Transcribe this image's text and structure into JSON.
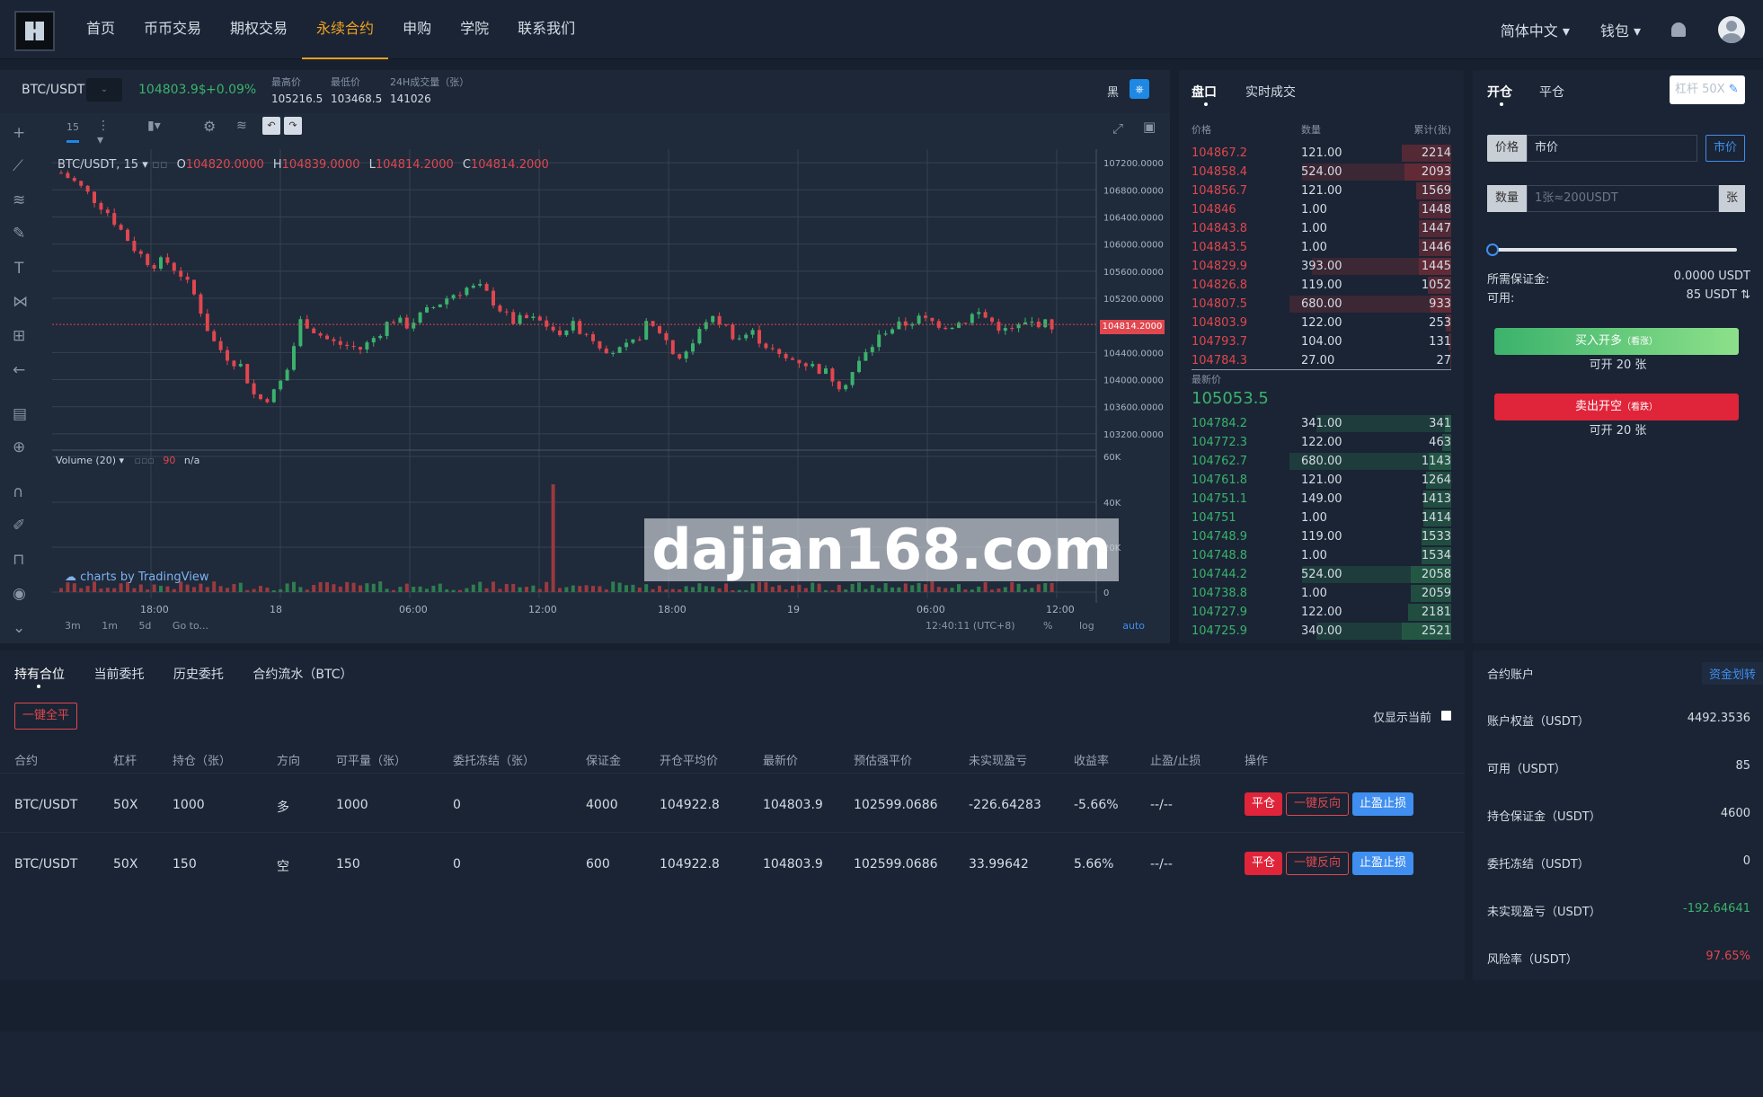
{
  "nav": {
    "items": [
      "首页",
      "币币交易",
      "期权交易",
      "永续合约",
      "申购",
      "学院",
      "联系我们"
    ],
    "active": 3,
    "lang": "简体中文",
    "wallet": "钱包"
  },
  "ticker": {
    "pair": "BTC/USDT",
    "price": "104803.9$",
    "change": "+0.09%",
    "high_label": "最高价",
    "high": "105216.5",
    "low_label": "最低价",
    "low": "103468.5",
    "vol_label": "24H成交量（张）",
    "vol": "141026",
    "theme": "黑"
  },
  "chart": {
    "interval": "15",
    "legend": "BTC/USDT, 15",
    "o": "104820.0000",
    "h": "104839.0000",
    "l": "104814.2000",
    "c": "104814.2000",
    "volume": "Volume (20)",
    "vol_n": "90",
    "vol_na": "n/a",
    "branding": "charts by TradingView",
    "watermark": "dajian168.com",
    "last_price": "104814.2000",
    "time": "12:40:11 (UTC+8)",
    "ranges": [
      "3m",
      "1m",
      "5d",
      "Go to..."
    ],
    "opts": [
      "%",
      "log",
      "auto"
    ]
  },
  "chart_data": {
    "type": "candlestick",
    "x_ticks": [
      "18:00",
      "18",
      "06:00",
      "12:00",
      "18:00",
      "19",
      "06:00",
      "12:00"
    ],
    "y_ticks": [
      "107200.0000",
      "106800.0000",
      "106400.0000",
      "106000.0000",
      "105600.0000",
      "105200.0000",
      "104400.0000",
      "104000.0000",
      "103600.0000",
      "103200.0000"
    ],
    "vol_ticks": [
      "60K",
      "40K",
      "20K",
      "0"
    ],
    "ylim": [
      103000,
      107400
    ],
    "close_path": [
      107050,
      106900,
      106700,
      106500,
      106200,
      105900,
      105700,
      105750,
      105550,
      105200,
      104600,
      104350,
      104200,
      103700,
      103750,
      104100,
      104900,
      104700,
      104550,
      104500,
      104450,
      104650,
      104900,
      104800,
      104950,
      105100,
      105250,
      105350,
      105350,
      105100,
      104850,
      104900,
      104850,
      104700,
      104800,
      104700,
      104500,
      104400,
      104500,
      104800,
      104700,
      104300,
      104500,
      104900,
      104850,
      104600,
      104700,
      104500,
      104300,
      104300,
      104200,
      104100,
      103900,
      104200,
      104500,
      104750,
      104800,
      104900,
      104850,
      104800,
      104850,
      105000,
      104850,
      104700,
      104800,
      104850,
      104800
    ]
  },
  "orderbook": {
    "tabs": [
      "盘口",
      "实时成交"
    ],
    "headers": [
      "价格",
      "数量",
      "累计(张)"
    ],
    "asks": [
      [
        "104867.2",
        "121.00",
        "2214"
      ],
      [
        "104858.4",
        "524.00",
        "2093"
      ],
      [
        "104856.7",
        "121.00",
        "1569"
      ],
      [
        "104846",
        "1.00",
        "1448"
      ],
      [
        "104843.8",
        "1.00",
        "1447"
      ],
      [
        "104843.5",
        "1.00",
        "1446"
      ],
      [
        "104829.9",
        "393.00",
        "1445"
      ],
      [
        "104826.8",
        "119.00",
        "1052"
      ],
      [
        "104807.5",
        "680.00",
        "933"
      ],
      [
        "104803.9",
        "122.00",
        "253"
      ],
      [
        "104793.7",
        "104.00",
        "131"
      ],
      [
        "104784.3",
        "27.00",
        "27"
      ]
    ],
    "mid_label": "最新价",
    "mid": "105053.5",
    "bids": [
      [
        "104784.2",
        "341.00",
        "341"
      ],
      [
        "104772.3",
        "122.00",
        "463"
      ],
      [
        "104762.7",
        "680.00",
        "1143"
      ],
      [
        "104761.8",
        "121.00",
        "1264"
      ],
      [
        "104751.1",
        "149.00",
        "1413"
      ],
      [
        "104751",
        "1.00",
        "1414"
      ],
      [
        "104748.9",
        "119.00",
        "1533"
      ],
      [
        "104748.8",
        "1.00",
        "1534"
      ],
      [
        "104744.2",
        "524.00",
        "2058"
      ],
      [
        "104738.8",
        "1.00",
        "2059"
      ],
      [
        "104727.9",
        "122.00",
        "2181"
      ],
      [
        "104725.9",
        "340.00",
        "2521"
      ]
    ]
  },
  "trade": {
    "tabs": [
      "开仓",
      "平仓"
    ],
    "leverage": "杠杆 50X",
    "price_label": "价格",
    "price_value": "市价",
    "market_btn": "市价",
    "qty_label": "数量",
    "qty_ph": "1张≈200USDT",
    "unit": "张",
    "margin_label": "所需保证金:",
    "margin": "0.0000 USDT",
    "avail_label": "可用:",
    "avail": "85 USDT",
    "buy": "买入开多",
    "buy_sub": "（看涨）",
    "buy_can": "可开 20 张",
    "sell": "卖出开空",
    "sell_sub": "（看跌）",
    "sell_can": "可开 20 张"
  },
  "positions": {
    "tabs": [
      "持有合位",
      "当前委托",
      "历史委托",
      "合约流水（BTC）"
    ],
    "close_all": "一键全平",
    "only_current": "仅显示当前",
    "headers": [
      "合约",
      "杠杆",
      "持仓（张）",
      "方向",
      "可平量（张）",
      "委托冻结（张）",
      "保证金",
      "开仓平均价",
      "最新价",
      "预估强平价",
      "未实现盈亏",
      "收益率",
      "止盈/止损",
      "操作"
    ],
    "rows": [
      [
        "BTC/USDT",
        "50X",
        "1000",
        "多",
        "1000",
        "0",
        "4000",
        "104922.8",
        "104803.9",
        "102599.0686",
        "-226.64283",
        "-5.66%",
        "--/--"
      ],
      [
        "BTC/USDT",
        "50X",
        "150",
        "空",
        "150",
        "0",
        "600",
        "104922.8",
        "104803.9",
        "102599.0686",
        "33.99642",
        "5.66%",
        "--/--"
      ]
    ],
    "actions": [
      "平仓",
      "一键反向",
      "止盈止损"
    ]
  },
  "account": {
    "title": "合约账户",
    "transfer": "资金划转",
    "rows": [
      [
        "账户权益（USDT）",
        "4492.3536"
      ],
      [
        "可用（USDT）",
        "85"
      ],
      [
        "持仓保证金（USDT）",
        "4600"
      ],
      [
        "委托冻结（USDT）",
        "0"
      ],
      [
        "未实现盈亏（USDT）",
        "-192.64641"
      ],
      [
        "风险率（USDT）",
        "97.65%"
      ]
    ]
  }
}
